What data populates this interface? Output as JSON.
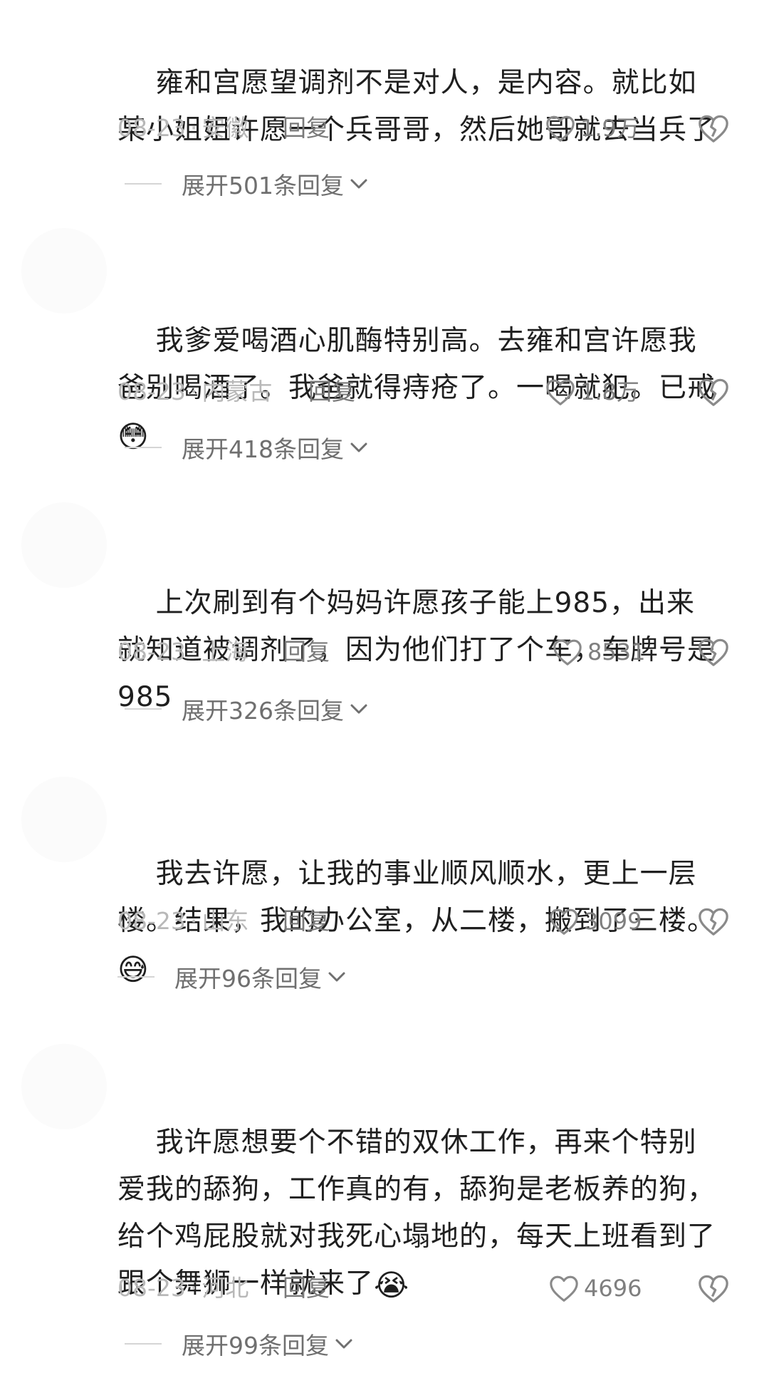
{
  "comments": [
    {
      "text": "雍和宫愿望调剂不是对人，是内容。就比如某小姐姐许愿一个兵哥哥，然后她哥就去当兵了",
      "emoji": "",
      "date": "08-23",
      "location": "安徽",
      "reply_label": "回复",
      "likes": "1.9万",
      "expand_label": "展开501条回复"
    },
    {
      "text": "我爹爱喝酒心肌酶特别高。去雍和宫许愿我爸别喝酒了。我爸就得痔疮了。一喝就犯。已戒",
      "emoji": "😳",
      "date": "08-23",
      "location": "内蒙古",
      "reply_label": "回复",
      "likes": "1.8万",
      "expand_label": "展开418条回复"
    },
    {
      "text": "上次刷到有个妈妈许愿孩子能上985，出来就知道被调剂了，因为他们打了个车，车牌号是985",
      "emoji": "",
      "date": "08-23",
      "location": "上海",
      "reply_label": "回复",
      "likes": "8531",
      "expand_label": "展开326条回复"
    },
    {
      "text": "我去许愿，让我的事业顺风顺水，更上一层楼。结果，我的办公室，从二楼，搬到了三楼。",
      "emoji": "😅",
      "date": "08-23",
      "location": "山东",
      "reply_label": "回复",
      "likes": "3099",
      "expand_label": "展开96条回复"
    },
    {
      "text": "我许愿想要个不错的双休工作，再来个特别爱我的舔狗，工作真的有，舔狗是老板养的狗，给个鸡屁股就对我死心塌地的，每天上班看到了跟个舞狮一样就来了",
      "emoji": "😭",
      "date": "08-23",
      "location": "河北",
      "reply_label": "回复",
      "likes": "4696",
      "expand_label": "展开99条回复"
    }
  ],
  "icons": {
    "like": "heart-outline-icon",
    "dislike": "broken-heart-icon",
    "expand": "chevron-down-icon"
  },
  "colors": {
    "text": "#1f1f1f",
    "meta": "#b8b8b8",
    "reply": "#7a7a7a",
    "count": "#7f7f7f"
  }
}
